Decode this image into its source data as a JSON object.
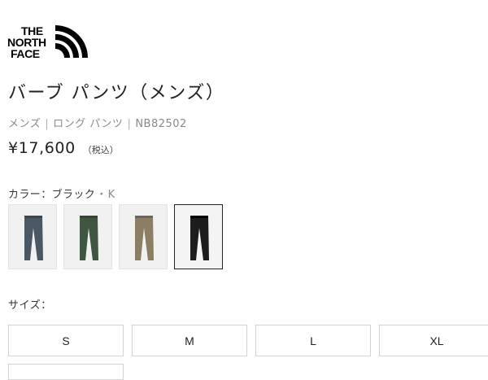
{
  "brand": {
    "logo_line1": "THE",
    "logo_line2": "NORTH",
    "logo_line3": "FACE"
  },
  "product": {
    "title": "バーブ パンツ（メンズ）",
    "category": "メンズ",
    "subcategory": "ロング パンツ",
    "sku": "NB82502",
    "separator": "|",
    "price": "¥17,600",
    "tax_note": "（税込）"
  },
  "color": {
    "label": "カラー：",
    "selected_name": "ブラック",
    "dot": "・",
    "selected_code": "K",
    "swatches": [
      {
        "name": "blue-gray",
        "hex": "#4a5863"
      },
      {
        "name": "dark-green",
        "hex": "#3f5640"
      },
      {
        "name": "khaki",
        "hex": "#8b7e64"
      },
      {
        "name": "black",
        "hex": "#1c1c1c",
        "selected": true
      }
    ]
  },
  "size": {
    "label": "サイズ：",
    "options": [
      "S",
      "M",
      "L",
      "XL",
      ""
    ]
  },
  "colors": {
    "text": "#222222",
    "muted": "#8a8a8a",
    "border": "#d4d4d4"
  }
}
